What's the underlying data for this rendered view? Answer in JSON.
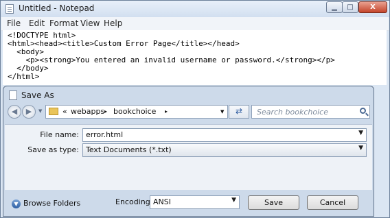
{
  "notepad": {
    "title": "Untitled - Notepad",
    "menu": [
      "File",
      "Edit",
      "Format",
      "View",
      "Help"
    ],
    "content_lines": [
      "<!DOCTYPE html>",
      "<html><head><title>Custom Error Page</title></head>",
      "  <body>",
      "    <p><strong>You entered an invalid username or password.</strong></p>",
      "  </body>",
      "</html>"
    ],
    "window_buttons": {
      "minimize": "▁",
      "maximize": "□",
      "close": "X"
    }
  },
  "dialog": {
    "title": "Save As",
    "breadcrumb": {
      "prefix": "«",
      "items": [
        "webapps",
        "bookchoice"
      ],
      "separator": "▸"
    },
    "search_placeholder": "Search bookchoice",
    "file_name_label": "File name:",
    "file_name_value": "error.html",
    "save_as_type_label": "Save as type:",
    "save_as_type_value": "Text Documents (*.txt)",
    "browse_folders_label": "Browse Folders",
    "encoding_label": "Encoding:",
    "encoding_value": "ANSI",
    "save_label": "Save",
    "cancel_label": "Cancel"
  }
}
